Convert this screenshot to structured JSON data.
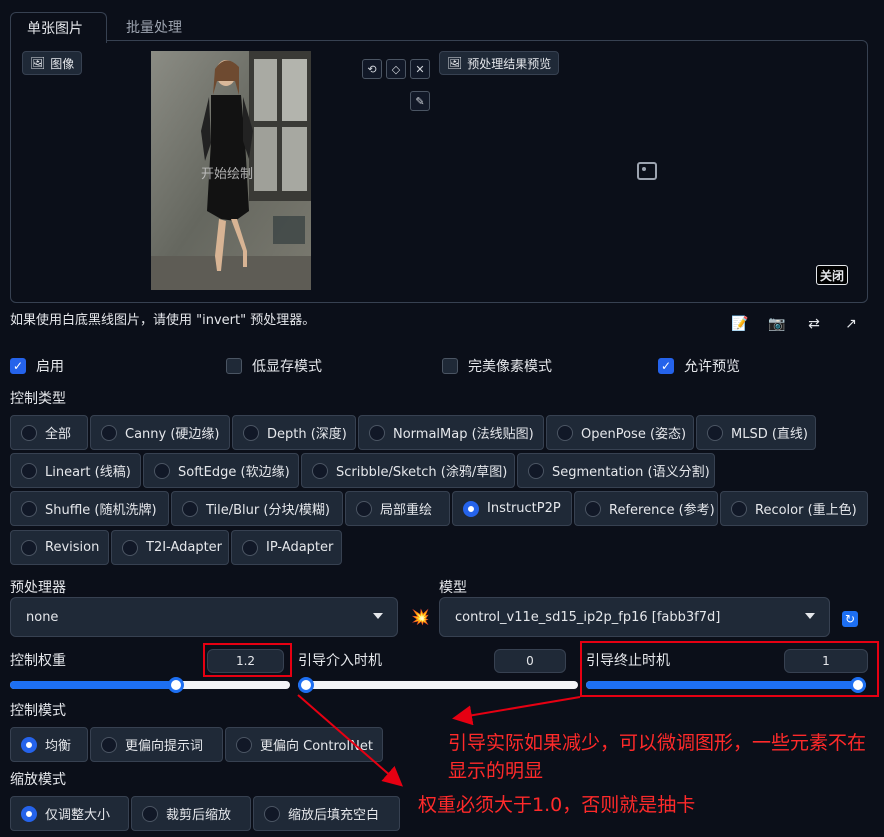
{
  "tabs": [
    {
      "label": "单张图片"
    },
    {
      "label": "批量处理"
    }
  ],
  "image_panel": {
    "image_label": "图像",
    "canvas_hint": "开始绘制",
    "preview_label": "预处理结果预览",
    "close_label": "关闭"
  },
  "note": "如果使用白底黑线图片，请使用 \"invert\" 预处理器。",
  "checkboxes": [
    {
      "label": "启用",
      "checked": true
    },
    {
      "label": "低显存模式",
      "checked": false
    },
    {
      "label": "完美像素模式",
      "checked": false
    },
    {
      "label": "允许预览",
      "checked": true
    }
  ],
  "control_type": {
    "title": "控制类型",
    "options": [
      {
        "label": "全部",
        "selected": false
      },
      {
        "label": "Canny (硬边缘)",
        "selected": false
      },
      {
        "label": "Depth (深度)",
        "selected": false
      },
      {
        "label": "NormalMap (法线贴图)",
        "selected": false
      },
      {
        "label": "OpenPose (姿态)",
        "selected": false
      },
      {
        "label": "MLSD (直线)",
        "selected": false
      },
      {
        "label": "Lineart (线稿)",
        "selected": false
      },
      {
        "label": "SoftEdge (软边缘)",
        "selected": false
      },
      {
        "label": "Scribble/Sketch (涂鸦/草图)",
        "selected": false
      },
      {
        "label": "Segmentation (语义分割)",
        "selected": false
      },
      {
        "label": "Shuffle (随机洗牌)",
        "selected": false
      },
      {
        "label": "Tile/Blur (分块/模糊)",
        "selected": false
      },
      {
        "label": "局部重绘",
        "selected": false
      },
      {
        "label": "InstructP2P",
        "selected": true
      },
      {
        "label": "Reference (参考)",
        "selected": false
      },
      {
        "label": "Recolor (重上色)",
        "selected": false
      },
      {
        "label": "Revision",
        "selected": false
      },
      {
        "label": "T2I-Adapter",
        "selected": false
      },
      {
        "label": "IP-Adapter",
        "selected": false
      }
    ]
  },
  "preprocessor": {
    "label": "预处理器",
    "value": "none"
  },
  "model": {
    "label": "模型",
    "value": "control_v11e_sd15_ip2p_fp16 [fabb3f7d]"
  },
  "sliders": {
    "weight": {
      "label": "控制权重",
      "value": "1.2",
      "fraction": 0.6
    },
    "start": {
      "label": "引导介入时机",
      "value": "0",
      "fraction": 0.0
    },
    "end": {
      "label": "引导终止时机",
      "value": "1",
      "fraction": 1.0
    }
  },
  "control_mode": {
    "title": "控制模式",
    "options": [
      {
        "label": "均衡",
        "selected": true
      },
      {
        "label": "更偏向提示词",
        "selected": false
      },
      {
        "label": "更偏向 ControlNet",
        "selected": false
      }
    ]
  },
  "resize_mode": {
    "title": "缩放模式",
    "options": [
      {
        "label": "仅调整大小",
        "selected": true
      },
      {
        "label": "裁剪后缩放",
        "selected": false
      },
      {
        "label": "缩放后填充空白",
        "selected": false
      }
    ]
  },
  "annotations": {
    "guidance_note": "引导实际如果减少，可以微调图形，一些元素不在显示的明显",
    "weight_note": "权重必须大于1.0，否则就是抽卡"
  },
  "colors": {
    "accent": "#1d6ff2",
    "annotation": "#e60012",
    "background": "#0b0f19"
  }
}
